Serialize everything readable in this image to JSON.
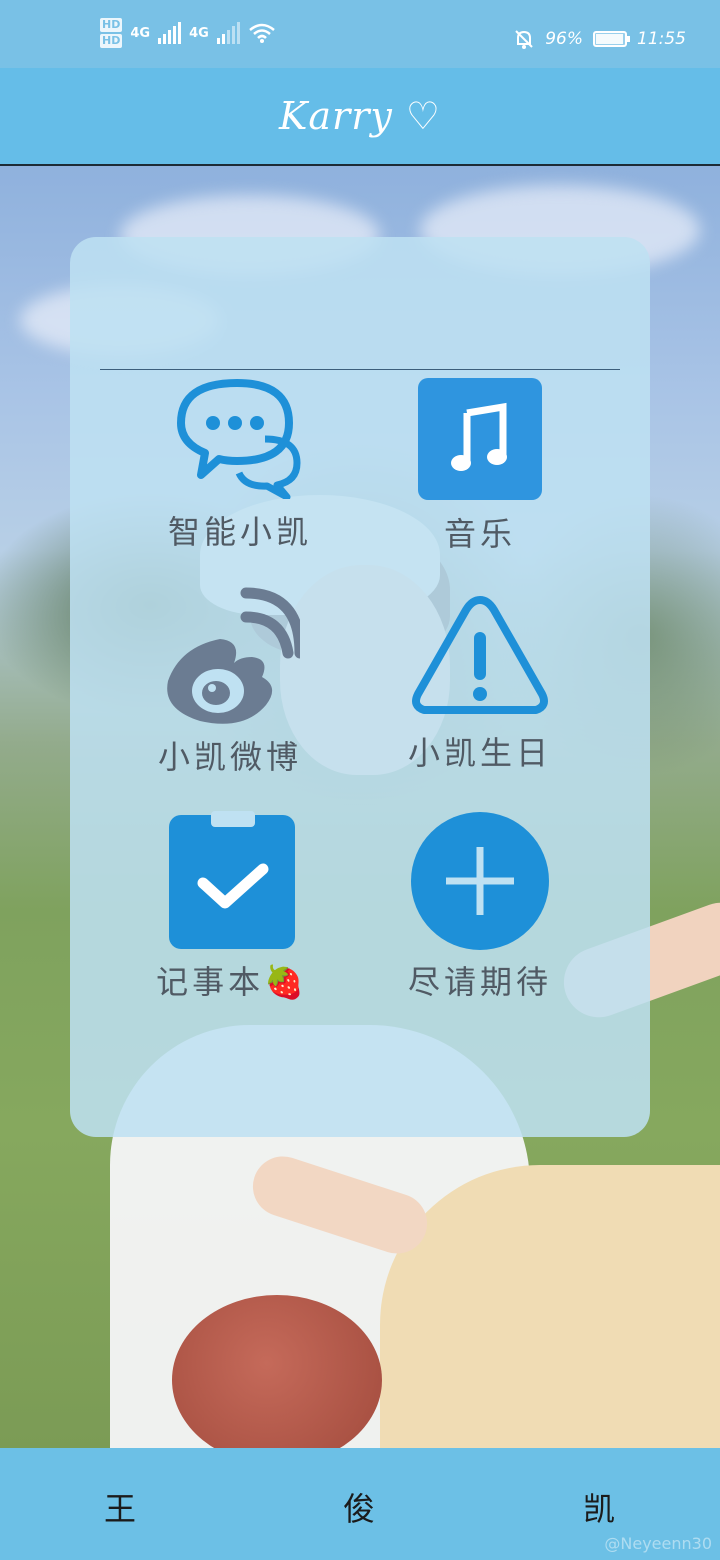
{
  "status_bar": {
    "hd_top": "HD",
    "hd_bottom": "HD",
    "net1": "4G",
    "net2": "4G",
    "battery_percent": "96%",
    "battery_level": 0.96,
    "time": "11:55"
  },
  "app_bar": {
    "title": "Karry ♡"
  },
  "grid": [
    {
      "label": "智能小凯",
      "icon": "chat-bubbles-icon",
      "color": "#1e90d8"
    },
    {
      "label": "音乐",
      "icon": "music-note-icon",
      "color": "#2f95df"
    },
    {
      "label": "小凯微博",
      "icon": "weibo-icon",
      "color": "#6b7c92"
    },
    {
      "label": "小凯生日",
      "icon": "warning-icon",
      "color": "#1e90d8"
    },
    {
      "label": "记事本🍓",
      "icon": "clipboard-check-icon",
      "color": "#1e90d8"
    },
    {
      "label": "尽请期待",
      "icon": "plus-circle-icon",
      "color": "#1e90d8"
    }
  ],
  "bottom_nav": {
    "left": "王",
    "center": "俊",
    "right": "凯"
  },
  "watermark": "@Neyeenn30"
}
